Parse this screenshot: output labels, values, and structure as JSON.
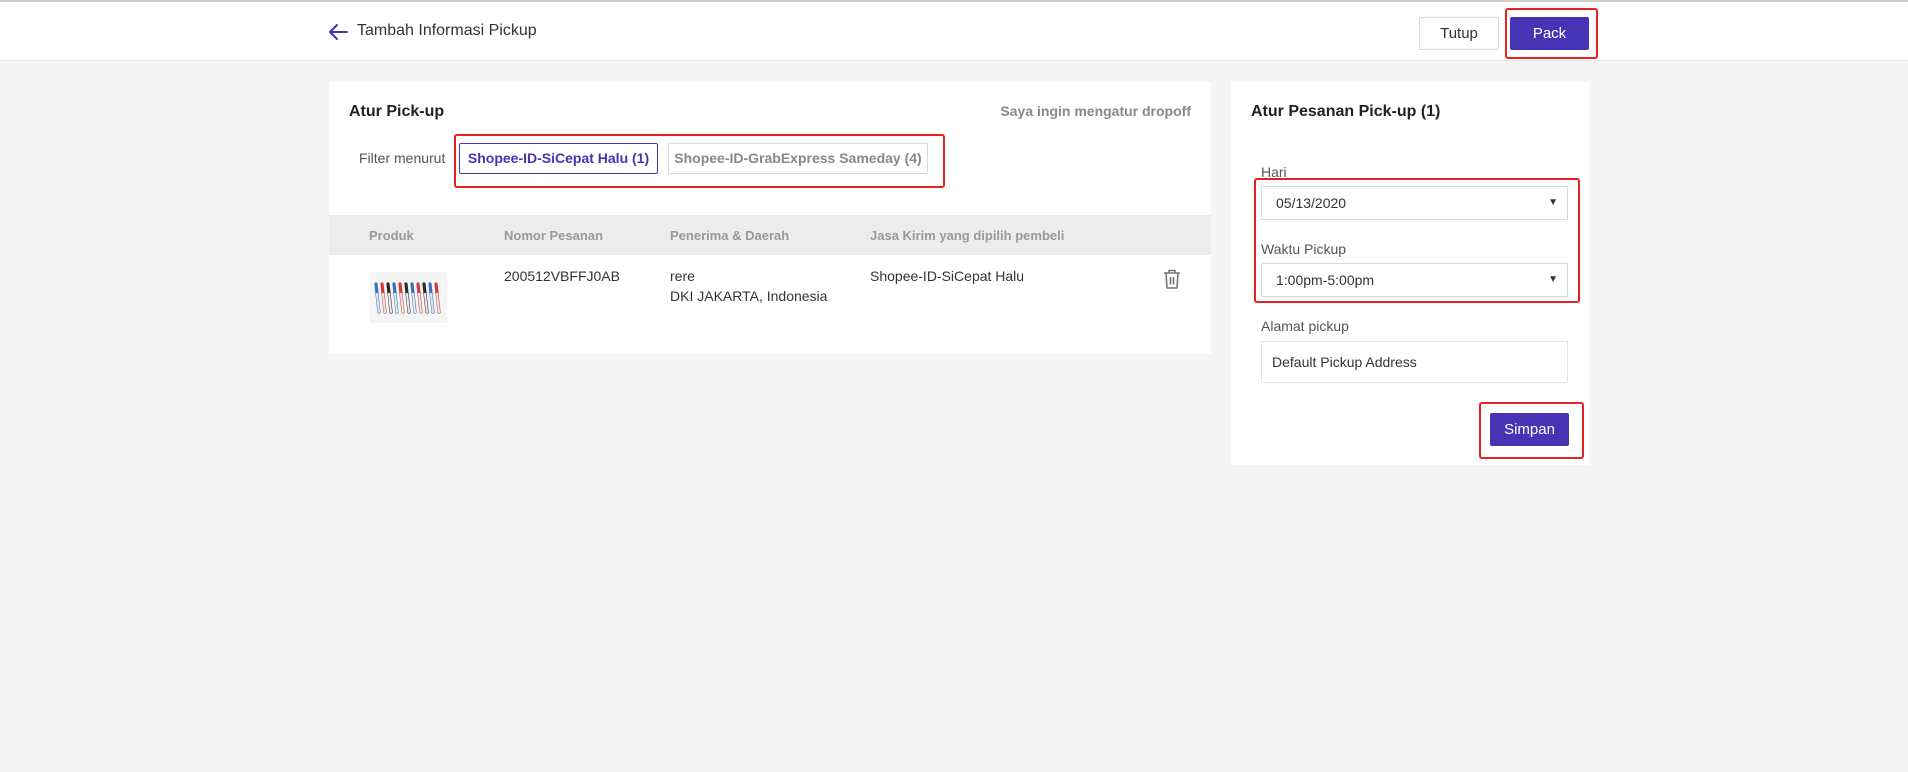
{
  "header": {
    "title": "Tambah Informasi Pickup",
    "close_label": "Tutup",
    "pack_label": "Pack"
  },
  "pickup": {
    "title": "Atur Pick-up",
    "dropoff_link": "Saya ingin mengatur dropoff",
    "filter_label": "Filter menurut",
    "filters": [
      {
        "label": "Shopee-ID-SiCepat Halu (1)",
        "active": true
      },
      {
        "label": "Shopee-ID-GrabExpress Sameday (4)",
        "active": false
      }
    ],
    "columns": [
      "Produk",
      "Nomor Pesanan",
      "Penerima & Daerah",
      "Jasa Kirim yang dipilih pembeli"
    ],
    "rows": [
      {
        "order_no": "200512VBFFJ0AB",
        "recipient": "rere",
        "region": "DKI JAKARTA, Indonesia",
        "courier": "Shopee-ID-SiCepat Halu"
      }
    ]
  },
  "order_settings": {
    "title": "Atur Pesanan Pick-up (1)",
    "day_label": "Hari",
    "day_value": "05/13/2020",
    "time_label": "Waktu Pickup",
    "time_value": "1:00pm-5:00pm",
    "address_label": "Alamat pickup",
    "address_value": "Default Pickup Address",
    "save_label": "Simpan"
  },
  "colors": {
    "accent": "#4634b4",
    "highlight": "#e82020",
    "background": "#f5f5f5"
  },
  "icons": {
    "back": "arrow-left-icon",
    "delete": "trash-icon",
    "dropdown": "caret-down-icon"
  }
}
